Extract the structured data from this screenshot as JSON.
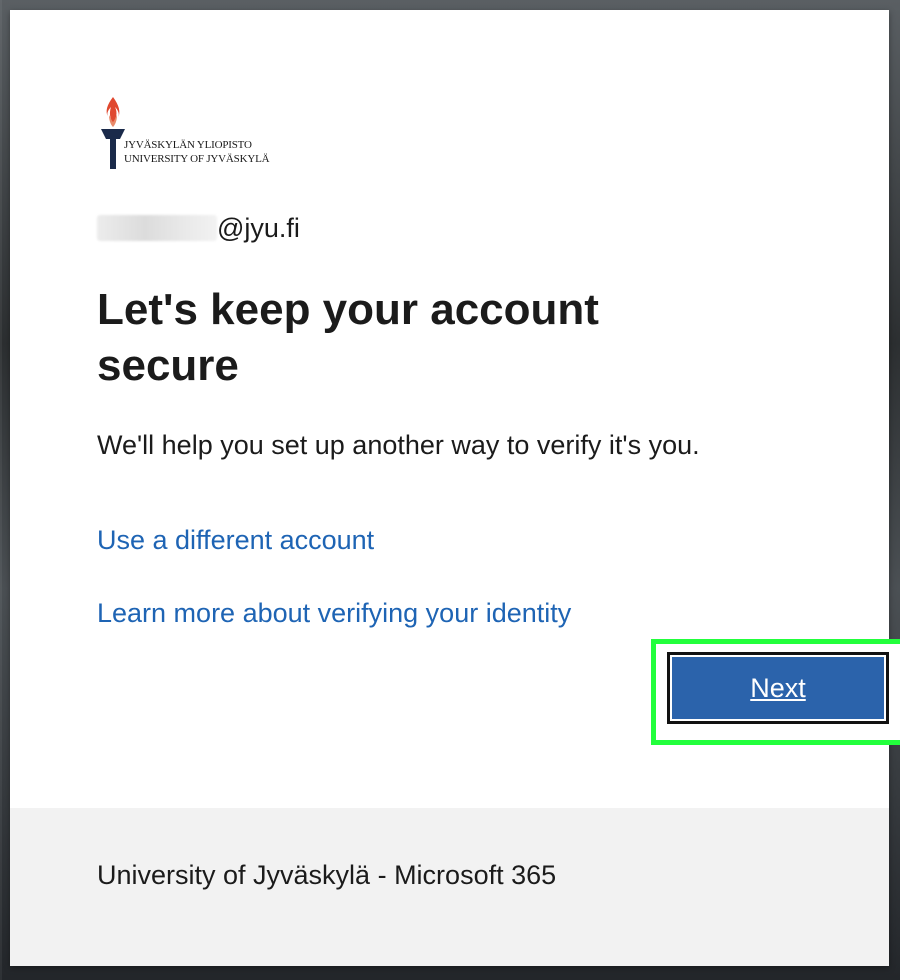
{
  "logo": {
    "line1": "JYVÄSKYLÄN YLIOPISTO",
    "line2": "UNIVERSITY OF JYVÄSKYLÄ",
    "flame_color": "#e0482f",
    "torch_color": "#1a2a4a"
  },
  "identity": {
    "email_domain": "@jyu.fi"
  },
  "title": "Let's keep your account secure",
  "description": "We'll help you set up another way to verify it's you.",
  "links": {
    "different_account": "Use a different account",
    "learn_more": "Learn more about verifying your identity"
  },
  "buttons": {
    "next": "Next"
  },
  "footer": {
    "text": "University of Jyväskylä - Microsoft 365"
  },
  "colors": {
    "link": "#1e64b4",
    "primary_button": "#2b63ab",
    "highlight": "#22ff3c",
    "footer_bg": "#f2f2f2"
  }
}
